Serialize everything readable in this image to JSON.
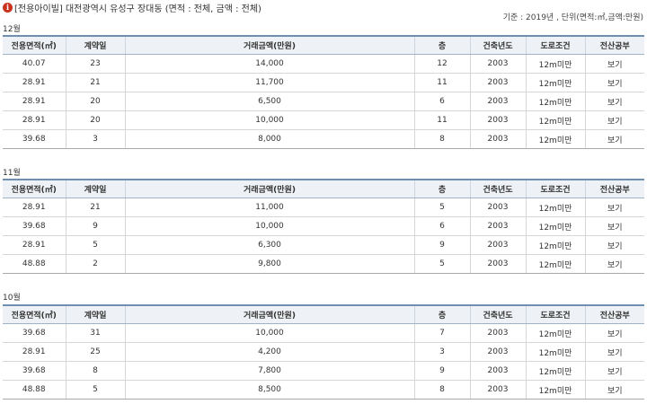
{
  "header": {
    "title": "[전용아이빌] 대전광역시 유성구 장대동 (면적 : 전체, 금액 : 전체)",
    "basis": "기준 : 2019년 , 단위(면적:㎡,금액:만원)"
  },
  "columns": [
    "전용면적(㎡)",
    "계약일",
    "거래금액(만원)",
    "층",
    "건축년도",
    "도로조건",
    "전산공부"
  ],
  "sections": [
    {
      "month": "12월",
      "rows": [
        {
          "area": "40.07",
          "day": "23",
          "price": "14,000",
          "floor": "12",
          "year": "2003",
          "road": "12m미만",
          "doc": "보기"
        },
        {
          "area": "28.91",
          "day": "21",
          "price": "11,700",
          "floor": "11",
          "year": "2003",
          "road": "12m미만",
          "doc": "보기"
        },
        {
          "area": "28.91",
          "day": "20",
          "price": "6,500",
          "floor": "6",
          "year": "2003",
          "road": "12m미만",
          "doc": "보기"
        },
        {
          "area": "28.91",
          "day": "20",
          "price": "10,000",
          "floor": "11",
          "year": "2003",
          "road": "12m미만",
          "doc": "보기"
        },
        {
          "area": "39.68",
          "day": "3",
          "price": "8,000",
          "floor": "8",
          "year": "2003",
          "road": "12m미만",
          "doc": "보기"
        }
      ]
    },
    {
      "month": "11월",
      "rows": [
        {
          "area": "28.91",
          "day": "21",
          "price": "11,000",
          "floor": "5",
          "year": "2003",
          "road": "12m미만",
          "doc": "보기"
        },
        {
          "area": "39.68",
          "day": "9",
          "price": "10,000",
          "floor": "6",
          "year": "2003",
          "road": "12m미만",
          "doc": "보기"
        },
        {
          "area": "28.91",
          "day": "5",
          "price": "6,300",
          "floor": "9",
          "year": "2003",
          "road": "12m미만",
          "doc": "보기"
        },
        {
          "area": "48.88",
          "day": "2",
          "price": "9,800",
          "floor": "5",
          "year": "2003",
          "road": "12m미만",
          "doc": "보기"
        }
      ]
    },
    {
      "month": "10월",
      "rows": [
        {
          "area": "39.68",
          "day": "31",
          "price": "10,000",
          "floor": "7",
          "year": "2003",
          "road": "12m미만",
          "doc": "보기"
        },
        {
          "area": "28.91",
          "day": "25",
          "price": "4,200",
          "floor": "3",
          "year": "2003",
          "road": "12m미만",
          "doc": "보기"
        },
        {
          "area": "39.68",
          "day": "8",
          "price": "7,800",
          "floor": "9",
          "year": "2003",
          "road": "12m미만",
          "doc": "보기"
        },
        {
          "area": "48.88",
          "day": "5",
          "price": "8,500",
          "floor": "8",
          "year": "2003",
          "road": "12m미만",
          "doc": "보기"
        }
      ]
    }
  ]
}
